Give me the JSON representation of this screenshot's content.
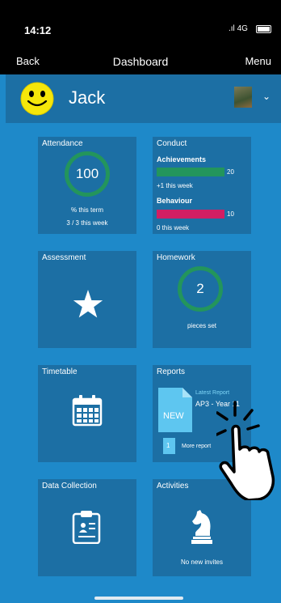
{
  "status": {
    "time": "14:12",
    "network": "4G"
  },
  "nav": {
    "back": "Back",
    "title": "Dashboard",
    "menu": "Menu"
  },
  "user": {
    "name": "Jack"
  },
  "tiles": {
    "attendance": {
      "title": "Attendance",
      "value": "100",
      "caption": "% this term",
      "subcaption": "3 / 3 this week"
    },
    "conduct": {
      "title": "Conduct",
      "achievements_label": "Achievements",
      "achievements_value": "20",
      "achievements_note": "+1 this week",
      "behaviour_label": "Behaviour",
      "behaviour_value": "10",
      "behaviour_note": "0 this week"
    },
    "assessment": {
      "title": "Assessment"
    },
    "homework": {
      "title": "Homework",
      "value": "2",
      "caption": "pieces set"
    },
    "timetable": {
      "title": "Timetable"
    },
    "reports": {
      "title": "Reports",
      "new_badge": "NEW",
      "latest_label": "Latest Report",
      "latest_title": "AP3 - Year 11",
      "more_count": "1",
      "more_label": "More report"
    },
    "data_collection": {
      "title": "Data Collection"
    },
    "activities": {
      "title": "Activities",
      "caption": "No new invites"
    }
  },
  "colors": {
    "background": "#1e89c9",
    "tile": "#1c6fa4",
    "green": "#23955c",
    "pink": "#d21e63"
  }
}
